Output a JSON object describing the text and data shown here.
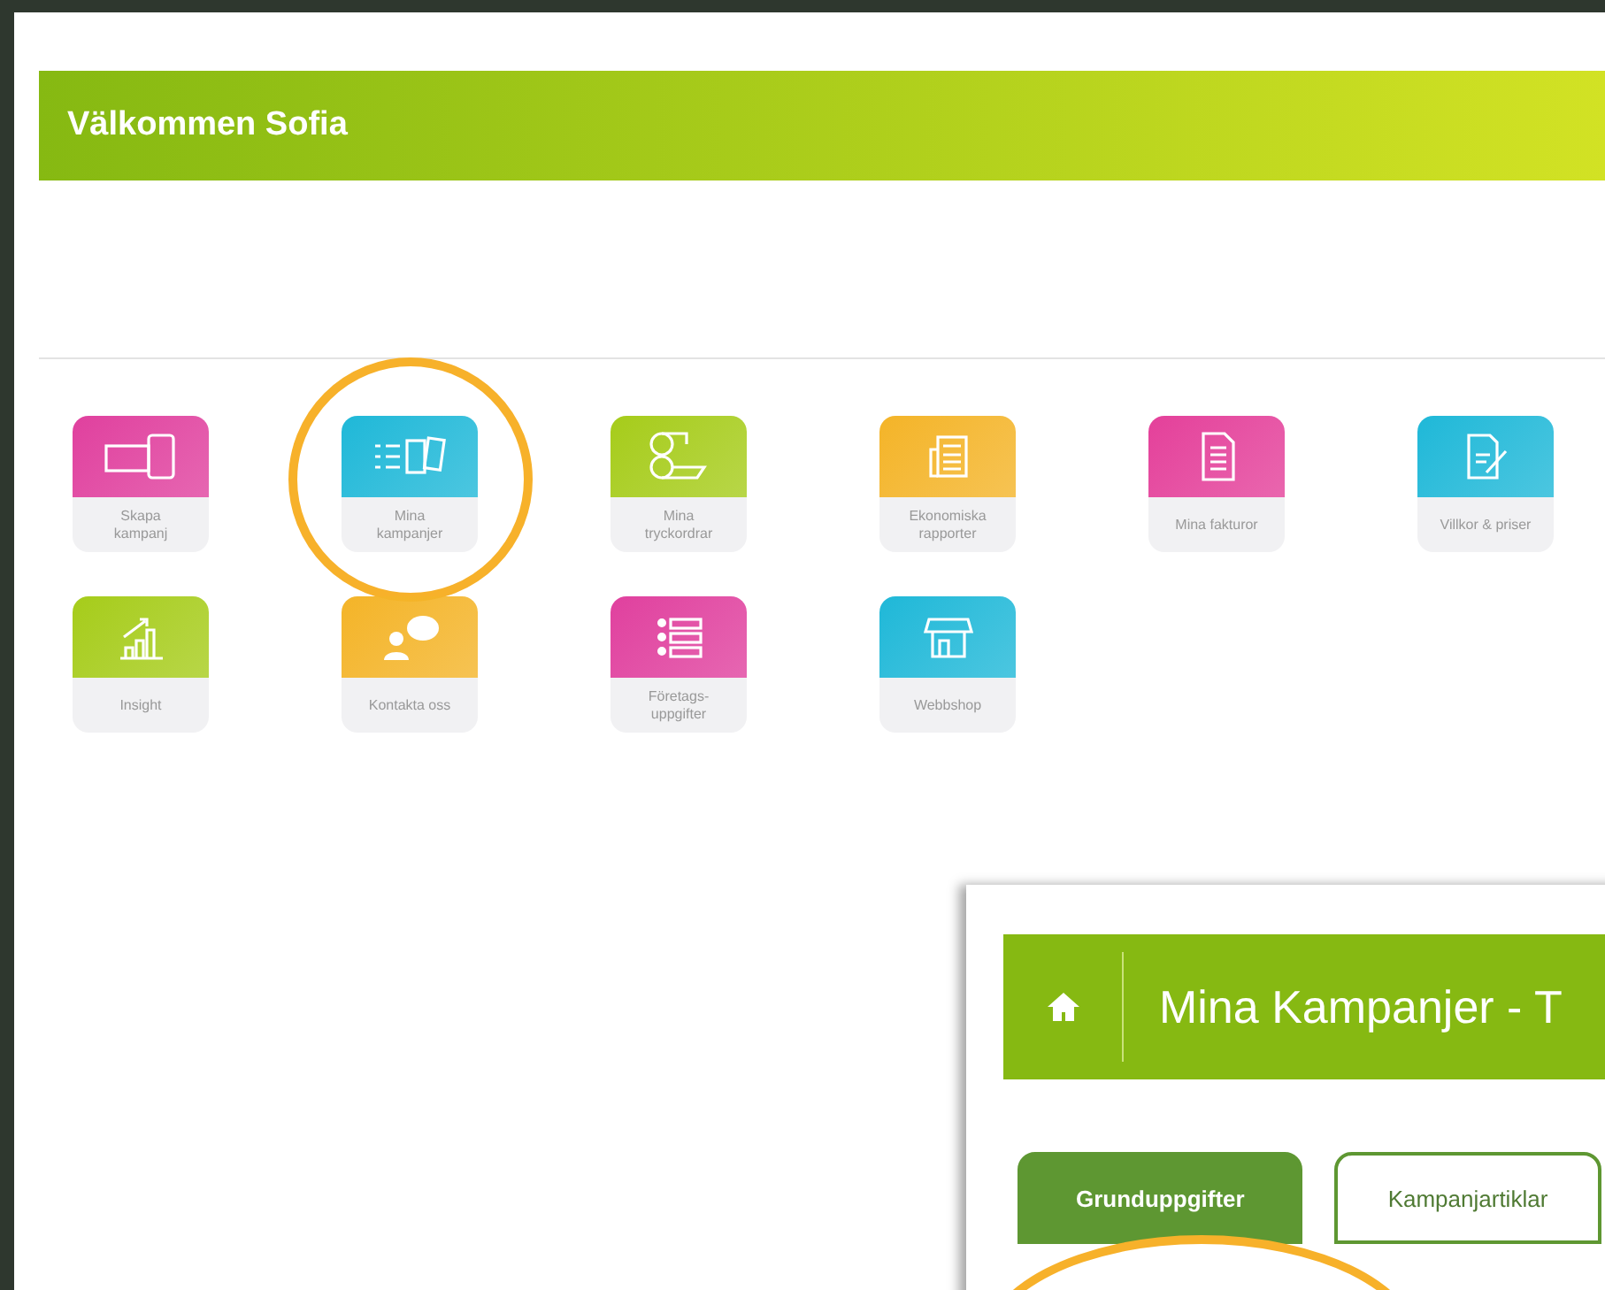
{
  "banner": {
    "title": "Välkommen Sofia"
  },
  "tiles": [
    {
      "label": "Skapa kampanj",
      "color": "#e0409e",
      "circled": false
    },
    {
      "label": "Mina kampanjer",
      "color": "#1fb8d8",
      "circled": true
    },
    {
      "label": "Mina tryckordrar",
      "color": "#a6cc1a",
      "circled": false
    },
    {
      "label": "Ekonomiska rapporter",
      "color": "#f4b428",
      "circled": false
    },
    {
      "label": "Mina fakturor",
      "color": "#e4409a",
      "circled": false
    },
    {
      "label": "Villkor & priser",
      "color": "#1fb8d8",
      "circled": false
    },
    {
      "label": "Insight",
      "color": "#a6cc1a",
      "circled": false
    },
    {
      "label": "Kontakta oss",
      "color": "#f4b428",
      "circled": false
    },
    {
      "label": "Företags-uppgifter",
      "color": "#e0409e",
      "circled": false
    },
    {
      "label": "Webbshop",
      "color": "#1fb8d8",
      "circled": false
    }
  ],
  "inset": {
    "title": "Mina Kampanjer - T",
    "content_circled": true,
    "tabs": [
      {
        "label": "Grunduppgifter",
        "selected": true
      },
      {
        "label": "Kampanjartiklar",
        "selected": false
      }
    ]
  }
}
